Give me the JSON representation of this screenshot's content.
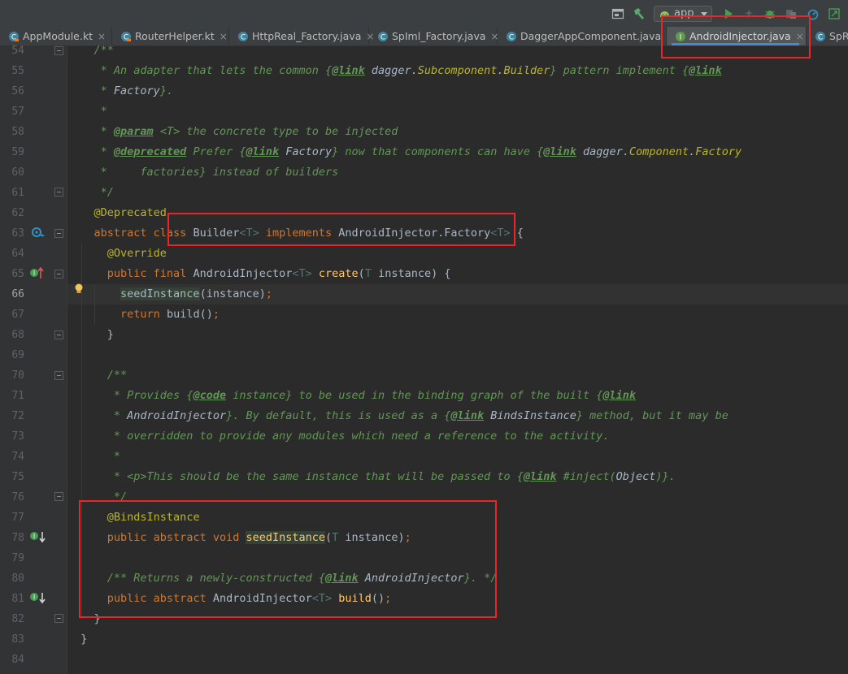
{
  "toolbar": {
    "run_config_label": "app",
    "icons": [
      "frame-icon",
      "hammer-build-icon",
      "android-icon",
      "run-icon",
      "debug-icon",
      "bug-icon",
      "profile-icon",
      "stopwatch-icon",
      "sdk-manager-icon"
    ]
  },
  "tabs": [
    {
      "label": "AppModule.kt",
      "icon": "kotlin-file-icon",
      "active": false
    },
    {
      "label": "RouterHelper.kt",
      "icon": "kotlin-file-icon",
      "active": false
    },
    {
      "label": "HttpReal_Factory.java",
      "icon": "java-class-icon",
      "active": false
    },
    {
      "label": "SpIml_Factory.java",
      "icon": "java-class-icon",
      "active": false
    },
    {
      "label": "DaggerAppComponent.java",
      "icon": "java-class-icon",
      "active": false
    },
    {
      "label": "AndroidInjector.java",
      "icon": "java-interface-icon",
      "active": true
    },
    {
      "label": "SpRe",
      "icon": "java-class-icon",
      "active": false
    }
  ],
  "tab_close_glyph": "×",
  "editor": {
    "current_line": "66",
    "lines": [
      {
        "n": "54",
        "tokens": [
          [
            "    /**",
            "com"
          ]
        ]
      },
      {
        "n": "55",
        "tokens": [
          [
            "     * An adapter that lets the common ",
            "com"
          ],
          [
            "{",
            "com"
          ],
          [
            "@link",
            "tag"
          ],
          [
            " dagger.",
            "ref"
          ],
          [
            "Subcomponent",
            "ref2"
          ],
          [
            ".",
            "ref"
          ],
          [
            "Builder",
            "ref2"
          ],
          [
            "}",
            "com"
          ],
          [
            " pattern implement ",
            "com"
          ],
          [
            "{",
            "com"
          ],
          [
            "@link",
            "tag"
          ]
        ]
      },
      {
        "n": "56",
        "tokens": [
          [
            "     * ",
            "com"
          ],
          [
            "Factory",
            "ref"
          ],
          [
            "}.",
            "com"
          ]
        ]
      },
      {
        "n": "57",
        "tokens": [
          [
            "     *",
            "com"
          ]
        ]
      },
      {
        "n": "58",
        "tokens": [
          [
            "     * ",
            "com"
          ],
          [
            "@param",
            "tag"
          ],
          [
            " <T> the concrete type to be injected",
            "com"
          ]
        ]
      },
      {
        "n": "59",
        "tokens": [
          [
            "     * ",
            "com"
          ],
          [
            "@deprecated",
            "tag"
          ],
          [
            " Prefer ",
            "com"
          ],
          [
            "{",
            "com"
          ],
          [
            "@link",
            "tag"
          ],
          [
            " Factory",
            "ref"
          ],
          [
            "}",
            "com"
          ],
          [
            " now that components can have ",
            "com"
          ],
          [
            "{",
            "com"
          ],
          [
            "@link",
            "tag"
          ],
          [
            " dagger.",
            "ref"
          ],
          [
            "Component",
            "ref2"
          ],
          [
            ".",
            "ref"
          ],
          [
            "Factory",
            "ref2"
          ]
        ]
      },
      {
        "n": "60",
        "tokens": [
          [
            "     *     factories} instead of builders",
            "com"
          ]
        ]
      },
      {
        "n": "61",
        "tokens": [
          [
            "     */",
            "com"
          ]
        ]
      },
      {
        "n": "62",
        "tokens": [
          [
            "    ",
            "plain"
          ],
          [
            "@Deprecated",
            "ann"
          ]
        ]
      },
      {
        "n": "63",
        "tokens": [
          [
            "    ",
            "plain"
          ],
          [
            "abstract class ",
            "kw"
          ],
          [
            "Builder",
            "plain"
          ],
          [
            "<T> ",
            "tp"
          ],
          [
            "implements ",
            "kw"
          ],
          [
            "AndroidInjector.Factory",
            "plain"
          ],
          [
            "<T>",
            "tp"
          ],
          [
            " {",
            "plain"
          ]
        ]
      },
      {
        "n": "64",
        "tokens": [
          [
            "      ",
            "plain"
          ],
          [
            "@Override",
            "ann"
          ]
        ]
      },
      {
        "n": "65",
        "tokens": [
          [
            "      ",
            "plain"
          ],
          [
            "public final ",
            "kw"
          ],
          [
            "AndroidInjector",
            "plain"
          ],
          [
            "<T> ",
            "tp"
          ],
          [
            "create",
            "meth"
          ],
          [
            "(",
            "plain"
          ],
          [
            "T ",
            "tp"
          ],
          [
            "instance) {",
            "plain"
          ]
        ]
      },
      {
        "n": "66",
        "tokens": [
          [
            "        ",
            "plain"
          ],
          [
            "seedInstance",
            "hl"
          ],
          [
            "(instance)",
            "plain"
          ],
          [
            ";",
            "kw"
          ]
        ]
      },
      {
        "n": "67",
        "tokens": [
          [
            "        ",
            "plain"
          ],
          [
            "return ",
            "kw"
          ],
          [
            "build()",
            "plain"
          ],
          [
            ";",
            "kw"
          ]
        ]
      },
      {
        "n": "68",
        "tokens": [
          [
            "      }",
            "plain"
          ]
        ]
      },
      {
        "n": "69",
        "tokens": [
          [
            "",
            "plain"
          ]
        ]
      },
      {
        "n": "70",
        "tokens": [
          [
            "      /**",
            "com"
          ]
        ]
      },
      {
        "n": "71",
        "tokens": [
          [
            "       * Provides ",
            "com"
          ],
          [
            "{",
            "com"
          ],
          [
            "@code",
            "tag"
          ],
          [
            " instance} to be used in the binding graph of the built ",
            "com"
          ],
          [
            "{",
            "com"
          ],
          [
            "@link",
            "tag"
          ]
        ]
      },
      {
        "n": "72",
        "tokens": [
          [
            "       * ",
            "com"
          ],
          [
            "AndroidInjector",
            "ref"
          ],
          [
            "}. By default, this is used as a ",
            "com"
          ],
          [
            "{",
            "com"
          ],
          [
            "@link",
            "tag"
          ],
          [
            " BindsInstance",
            "ref"
          ],
          [
            "}",
            "com"
          ],
          [
            " method, but it may be",
            "com"
          ]
        ]
      },
      {
        "n": "73",
        "tokens": [
          [
            "       * overridden to provide any modules which need a reference to the activity.",
            "com"
          ]
        ]
      },
      {
        "n": "74",
        "tokens": [
          [
            "       *",
            "com"
          ]
        ]
      },
      {
        "n": "75",
        "tokens": [
          [
            "       * ",
            "com"
          ],
          [
            "<p>",
            "com"
          ],
          [
            "This should be the same instance that will be passed to ",
            "com"
          ],
          [
            "{",
            "com"
          ],
          [
            "@link",
            "tag"
          ],
          [
            " #inject(",
            "com"
          ],
          [
            "Object",
            "ref"
          ],
          [
            ")}.",
            "com"
          ]
        ]
      },
      {
        "n": "76",
        "tokens": [
          [
            "       */",
            "com"
          ]
        ]
      },
      {
        "n": "77",
        "tokens": [
          [
            "      ",
            "plain"
          ],
          [
            "@BindsInstance",
            "ann"
          ]
        ]
      },
      {
        "n": "78",
        "tokens": [
          [
            "      ",
            "plain"
          ],
          [
            "public abstract void ",
            "kw"
          ],
          [
            "seedInstance",
            "methhl"
          ],
          [
            "(",
            "plain"
          ],
          [
            "T ",
            "tp"
          ],
          [
            "instance)",
            "plain"
          ],
          [
            ";",
            "kw"
          ]
        ]
      },
      {
        "n": "79",
        "tokens": [
          [
            "",
            "plain"
          ]
        ]
      },
      {
        "n": "80",
        "tokens": [
          [
            "      /** Returns a newly-constructed ",
            "com"
          ],
          [
            "{",
            "com"
          ],
          [
            "@link",
            "tag"
          ],
          [
            " AndroidInjector",
            "ref"
          ],
          [
            "}. */",
            "com"
          ]
        ]
      },
      {
        "n": "81",
        "tokens": [
          [
            "      ",
            "plain"
          ],
          [
            "public abstract ",
            "kw"
          ],
          [
            "AndroidInjector",
            "plain"
          ],
          [
            "<T> ",
            "tp"
          ],
          [
            "build",
            "meth"
          ],
          [
            "()",
            "plain"
          ],
          [
            ";",
            "kw"
          ]
        ]
      },
      {
        "n": "82",
        "tokens": [
          [
            "    }",
            "plain"
          ]
        ]
      },
      {
        "n": "83",
        "tokens": [
          [
            "  }",
            "plain"
          ]
        ]
      },
      {
        "n": "84",
        "tokens": [
          [
            "",
            "plain"
          ]
        ]
      }
    ]
  },
  "colors": {
    "red_highlight": "#e8272d",
    "active_tab_underline": "#4a88c7",
    "comment": "#629755",
    "keyword": "#cc7832",
    "annotation": "#bbb529",
    "method": "#ffc66d"
  }
}
